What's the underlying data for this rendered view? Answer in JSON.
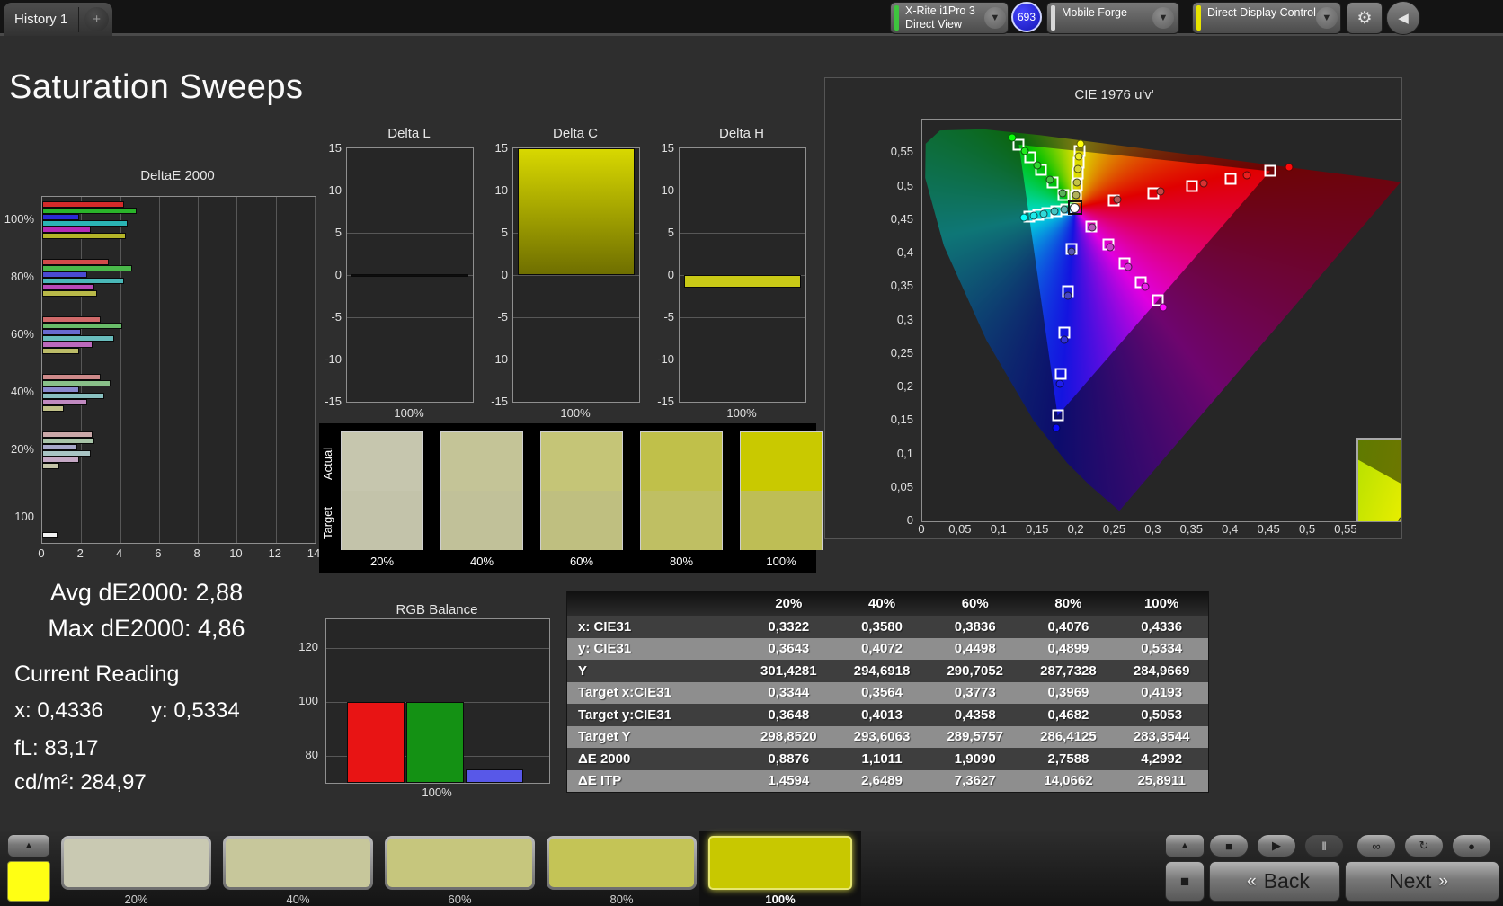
{
  "topbar": {
    "tab_label": "History 1",
    "add_tab": "+",
    "dropdown_icon": "▼",
    "meter": {
      "line1": "X-Rite i1Pro 3",
      "line2": "Direct View",
      "stripe_color": "#3ec43e",
      "badge": "693"
    },
    "source": {
      "line1": "Mobile Forge",
      "stripe_color": "#d8d8d8"
    },
    "workflow": {
      "line1": "Direct Display Control",
      "stripe_color": "#e8e400"
    },
    "gear_icon": "⚙",
    "collapse_icon": "◀"
  },
  "page_title": "Saturation Sweeps",
  "summary": {
    "avg": "Avg dE2000: 2,88",
    "max": "Max dE2000: 4,86",
    "current_title": "Current Reading",
    "x": "x: 0,4336",
    "y": "y: 0,5334",
    "fl": "fL: 83,17",
    "cdm2": "cd/m²: 284,97"
  },
  "swatch_compare": {
    "actual_label": "Actual",
    "target_label": "Target",
    "items": [
      {
        "label": "20%",
        "actual": "#c6c6ae",
        "target": "#c3c3aa"
      },
      {
        "label": "40%",
        "actual": "#c4c497",
        "target": "#c1c199"
      },
      {
        "label": "60%",
        "actual": "#c5c577",
        "target": "#bfbf80"
      },
      {
        "label": "80%",
        "actual": "#c0c04a",
        "target": "#bfbf63"
      },
      {
        "label": "100%",
        "actual": "#c9c900",
        "target": "#bebe55"
      }
    ]
  },
  "bottombar": {
    "expand_icon": "▲",
    "sample_color": "#ffff14",
    "patches": [
      {
        "label": "20%",
        "color": "#c9c9b2",
        "selected": false
      },
      {
        "label": "40%",
        "color": "#c7c79b",
        "selected": false
      },
      {
        "label": "60%",
        "color": "#c6c67d",
        "selected": false
      },
      {
        "label": "80%",
        "color": "#c4c456",
        "selected": false
      },
      {
        "label": "100%",
        "color": "#c8c800",
        "selected": true
      }
    ],
    "transport": [
      {
        "name": "stop-button",
        "icon": "■",
        "pressed": false
      },
      {
        "name": "play-button",
        "icon": "▶",
        "pressed": false
      },
      {
        "name": "pause-button",
        "icon": "‖",
        "pressed": true
      },
      {
        "name": "loop-button",
        "icon": "∞",
        "pressed": false
      },
      {
        "name": "refresh-button",
        "icon": "↻",
        "pressed": false
      },
      {
        "name": "record-button",
        "icon": "●",
        "pressed": false
      }
    ],
    "stop_square_icon": "■",
    "back_label": "Back",
    "next_label": "Next",
    "back_chevron": "«",
    "next_chevron": "»"
  },
  "chart_data": [
    {
      "id": "deltae2000",
      "type": "bar",
      "orientation": "horizontal",
      "title": "DeltaE 2000",
      "xlim": [
        0,
        14
      ],
      "xticks": [
        0,
        2,
        4,
        6,
        8,
        10,
        12,
        14
      ],
      "series_order": [
        "red",
        "green",
        "blue",
        "cyan",
        "magenta",
        "yellow"
      ],
      "series_colors": [
        "#d42a2a",
        "#2ab42a",
        "#2a2ad4",
        "#2ab4b4",
        "#b42ab4",
        "#b4b428"
      ],
      "groups": [
        {
          "label": "100%",
          "sat": 1.0,
          "values": [
            4.2,
            4.86,
            1.9,
            4.4,
            2.5,
            4.3
          ]
        },
        {
          "label": "80%",
          "sat": 0.8,
          "values": [
            3.4,
            4.6,
            2.3,
            4.2,
            2.7,
            2.8
          ]
        },
        {
          "label": "60%",
          "sat": 0.6,
          "values": [
            3.0,
            4.1,
            2.0,
            3.7,
            2.6,
            1.9
          ]
        },
        {
          "label": "40%",
          "sat": 0.4,
          "values": [
            3.0,
            3.5,
            1.9,
            3.2,
            2.3,
            1.1
          ]
        },
        {
          "label": "20%",
          "sat": 0.2,
          "values": [
            2.6,
            2.7,
            1.8,
            2.5,
            1.9,
            0.9
          ]
        },
        {
          "label": "100",
          "sat": 0.0,
          "values": [
            0.8
          ],
          "colors": [
            "#f2f2f2"
          ]
        }
      ]
    },
    {
      "id": "delta_l",
      "type": "bar",
      "title": "Delta L",
      "ylim": [
        -15,
        15
      ],
      "yticks": [
        15,
        10,
        5,
        0,
        -5,
        -10,
        -15
      ],
      "xlabel": "100%",
      "value": 0.1,
      "bar_color": "#0d0d0d",
      "clipped": false
    },
    {
      "id": "delta_c",
      "type": "bar",
      "title": "Delta C",
      "ylim": [
        -15,
        15
      ],
      "yticks": [
        15,
        10,
        5,
        0,
        -5,
        -10,
        -15
      ],
      "xlabel": "100%",
      "value": 15.6,
      "bar_color": "yellow-gradient",
      "clipped": true
    },
    {
      "id": "delta_h",
      "type": "bar",
      "title": "Delta H",
      "ylim": [
        -15,
        15
      ],
      "yticks": [
        15,
        10,
        5,
        0,
        -5,
        -10,
        -15
      ],
      "xlabel": "100%",
      "value": -1.5,
      "bar_color": "#c9c916",
      "clipped": false
    },
    {
      "id": "rgb_balance",
      "type": "bar",
      "title": "RGB Balance",
      "categories": [
        "Red",
        "Green",
        "Blue"
      ],
      "values": [
        100,
        100,
        75
      ],
      "colors": [
        "#e81414",
        "#149114",
        "#5858e8"
      ],
      "ylim": [
        70,
        130.7
      ],
      "yticks": [
        80,
        100,
        120
      ],
      "xlabel": "100%"
    },
    {
      "id": "cie1976",
      "type": "scatter",
      "title": "CIE 1976 u'v'",
      "xlim": [
        0,
        0.62
      ],
      "ylim": [
        0,
        0.6
      ],
      "x_ticks": [
        "0",
        "0,05",
        "0,1",
        "0,15",
        "0,2",
        "0,25",
        "0,3",
        "0,35",
        "0,4",
        "0,45",
        "0,5",
        "0,55"
      ],
      "y_ticks": [
        "0",
        "0,05",
        "0,1",
        "0,15",
        "0,2",
        "0,25",
        "0,3",
        "0,35",
        "0,4",
        "0,45",
        "0,5",
        "0,55"
      ],
      "whitepoint": [
        0.1978,
        0.4683
      ],
      "series": [
        {
          "name": "red",
          "hue": 0,
          "targets": [
            [
              0.2484,
              0.4792
            ],
            [
              0.299,
              0.4901
            ],
            [
              0.3495,
              0.5011
            ],
            [
              0.4001,
              0.512
            ],
            [
              0.4507,
              0.5229
            ]
          ],
          "measured": [
            [
              0.2534,
              0.4803
            ],
            [
              0.3091,
              0.4923
            ],
            [
              0.3647,
              0.5043
            ],
            [
              0.4204,
              0.5163
            ],
            [
              0.476,
              0.5284
            ]
          ]
        },
        {
          "name": "green",
          "hue": 120,
          "targets": [
            [
              0.1832,
              0.4871
            ],
            [
              0.1687,
              0.506
            ],
            [
              0.1541,
              0.5248
            ],
            [
              0.1396,
              0.5437
            ],
            [
              0.125,
              0.5625
            ]
          ],
          "measured": [
            [
              0.1815,
              0.4894
            ],
            [
              0.1652,
              0.5105
            ],
            [
              0.1489,
              0.5316
            ],
            [
              0.1326,
              0.5527
            ],
            [
              0.1163,
              0.5738
            ]
          ]
        },
        {
          "name": "blue",
          "hue": 240,
          "targets": [
            [
              0.1933,
              0.4062
            ],
            [
              0.1888,
              0.3441
            ],
            [
              0.1844,
              0.2821
            ],
            [
              0.1799,
              0.22
            ],
            [
              0.1754,
              0.1579
            ]
          ],
          "measured": [
            [
              0.1931,
              0.4025
            ],
            [
              0.1883,
              0.3367
            ],
            [
              0.1836,
              0.2709
            ],
            [
              0.1788,
              0.2051
            ],
            [
              0.1741,
              0.1393
            ]
          ]
        },
        {
          "name": "cyan",
          "hue": 180,
          "targets": [
            [
              0.1859,
              0.4657
            ],
            [
              0.174,
              0.4631
            ],
            [
              0.1621,
              0.4606
            ],
            [
              0.1502,
              0.458
            ],
            [
              0.1383,
              0.4554
            ]
          ],
          "measured": [
            [
              0.1845,
              0.4654
            ],
            [
              0.1711,
              0.4625
            ],
            [
              0.1578,
              0.4596
            ],
            [
              0.1445,
              0.4567
            ],
            [
              0.1312,
              0.4539
            ]
          ]
        },
        {
          "name": "magenta",
          "hue": 300,
          "targets": [
            [
              0.2192,
              0.4406
            ],
            [
              0.2407,
              0.4129
            ],
            [
              0.2621,
              0.3852
            ],
            [
              0.2836,
              0.3575
            ],
            [
              0.305,
              0.3298
            ]
          ],
          "measured": [
            [
              0.2207,
              0.4387
            ],
            [
              0.2437,
              0.409
            ],
            [
              0.2666,
              0.3794
            ],
            [
              0.2896,
              0.3497
            ],
            [
              0.3125,
              0.3201
            ]
          ]
        },
        {
          "name": "yellow",
          "hue": 60,
          "targets": [
            [
              0.199,
              0.4852
            ],
            [
              0.2002,
              0.5021
            ],
            [
              0.2015,
              0.5191
            ],
            [
              0.2027,
              0.536
            ],
            [
              0.2039,
              0.5529
            ]
          ],
          "measured": [
            [
              0.1992,
              0.4874
            ],
            [
              0.2006,
              0.5065
            ],
            [
              0.2019,
              0.5257
            ],
            [
              0.2033,
              0.5448
            ],
            [
              0.2047,
              0.5639
            ]
          ]
        }
      ],
      "inset": {
        "square": [
          0.48,
          0.48
        ],
        "circles": [
          [
            0.72,
            0.15
          ],
          [
            0.33,
            0.72
          ]
        ]
      }
    },
    {
      "id": "sweep_table",
      "type": "table",
      "headers": [
        "",
        "20%",
        "40%",
        "60%",
        "80%",
        "100%"
      ],
      "rows": [
        {
          "label": "x: CIE31",
          "values": [
            "0,3322",
            "0,3580",
            "0,3836",
            "0,4076",
            "0,4336"
          ]
        },
        {
          "label": "y: CIE31",
          "values": [
            "0,3643",
            "0,4072",
            "0,4498",
            "0,4899",
            "0,5334"
          ]
        },
        {
          "label": "Y",
          "values": [
            "301,4281",
            "294,6918",
            "290,7052",
            "287,7328",
            "284,9669"
          ]
        },
        {
          "label": "Target x:CIE31",
          "values": [
            "0,3344",
            "0,3564",
            "0,3773",
            "0,3969",
            "0,4193"
          ]
        },
        {
          "label": "Target y:CIE31",
          "values": [
            "0,3648",
            "0,4013",
            "0,4358",
            "0,4682",
            "0,5053"
          ]
        },
        {
          "label": "Target Y",
          "values": [
            "298,8520",
            "293,6063",
            "289,5757",
            "286,4125",
            "283,3544"
          ]
        },
        {
          "label": "ΔE 2000",
          "values": [
            "0,8876",
            "1,1011",
            "1,9090",
            "2,7588",
            "4,2992"
          ]
        },
        {
          "label": "ΔE ITP",
          "values": [
            "1,4594",
            "2,6489",
            "7,3627",
            "14,0662",
            "25,8911"
          ]
        }
      ]
    }
  ]
}
